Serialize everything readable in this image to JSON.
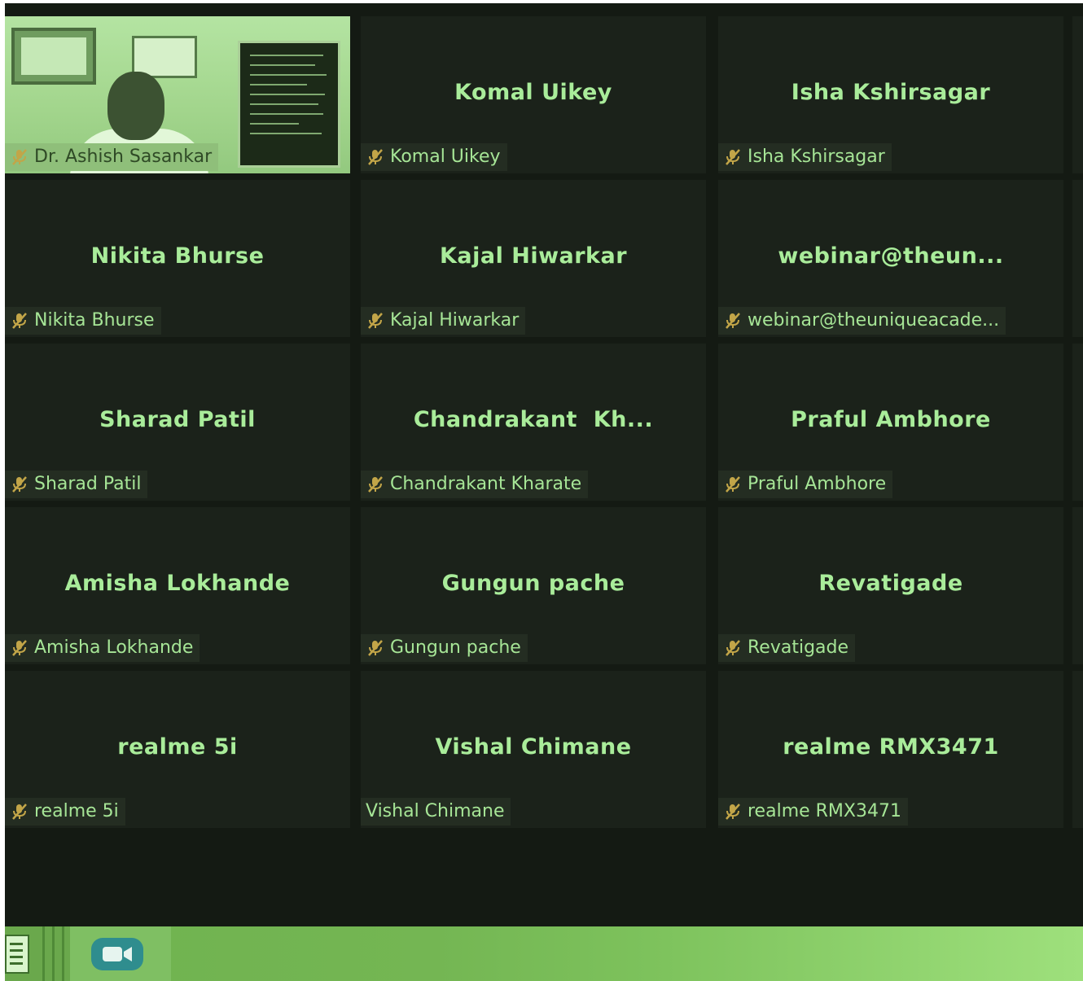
{
  "participants": [
    {
      "display": "",
      "tag": "Dr. Ashish Sasankar",
      "muted": true,
      "video": true
    },
    {
      "display": "Komal Uikey",
      "tag": "Komal Uikey",
      "muted": true
    },
    {
      "display": "Isha Kshirsagar",
      "tag": "Isha Kshirsagar",
      "muted": true
    },
    {
      "display": "Nikita Bhurse",
      "tag": "Nikita Bhurse",
      "muted": true
    },
    {
      "display": "Kajal Hiwarkar",
      "tag": "Kajal Hiwarkar",
      "muted": true
    },
    {
      "display": "webinar@theun...",
      "tag": "webinar@theuniqueacade...",
      "muted": true
    },
    {
      "display": "Sharad Patil",
      "tag": "Sharad Patil",
      "muted": true
    },
    {
      "display": "Chandrakant  Kh...",
      "tag": "Chandrakant Kharate",
      "muted": true
    },
    {
      "display": "Praful Ambhore",
      "tag": "Praful Ambhore",
      "muted": true
    },
    {
      "display": "Amisha Lokhande",
      "tag": "Amisha Lokhande",
      "muted": true
    },
    {
      "display": "Gungun pache",
      "tag": "Gungun pache",
      "muted": true
    },
    {
      "display": "Revatigade",
      "tag": "Revatigade",
      "muted": true
    },
    {
      "display": "realme 5i",
      "tag": "realme 5i",
      "muted": true
    },
    {
      "display": "Vishal Chimane",
      "tag": "Vishal Chimane",
      "muted": false
    },
    {
      "display": "realme RMX3471",
      "tag": "realme RMX3471",
      "muted": true
    }
  ],
  "taskbar": {
    "apps": [
      {
        "icon": "notes-app-icon"
      },
      {
        "icon": "zoom-video-icon",
        "active": true
      }
    ]
  },
  "colors": {
    "tile_bg": "#1b221a",
    "text": "#a9ec9a",
    "muted_icon": "#c2a548",
    "zoom_blue": "#2f8d8e"
  }
}
